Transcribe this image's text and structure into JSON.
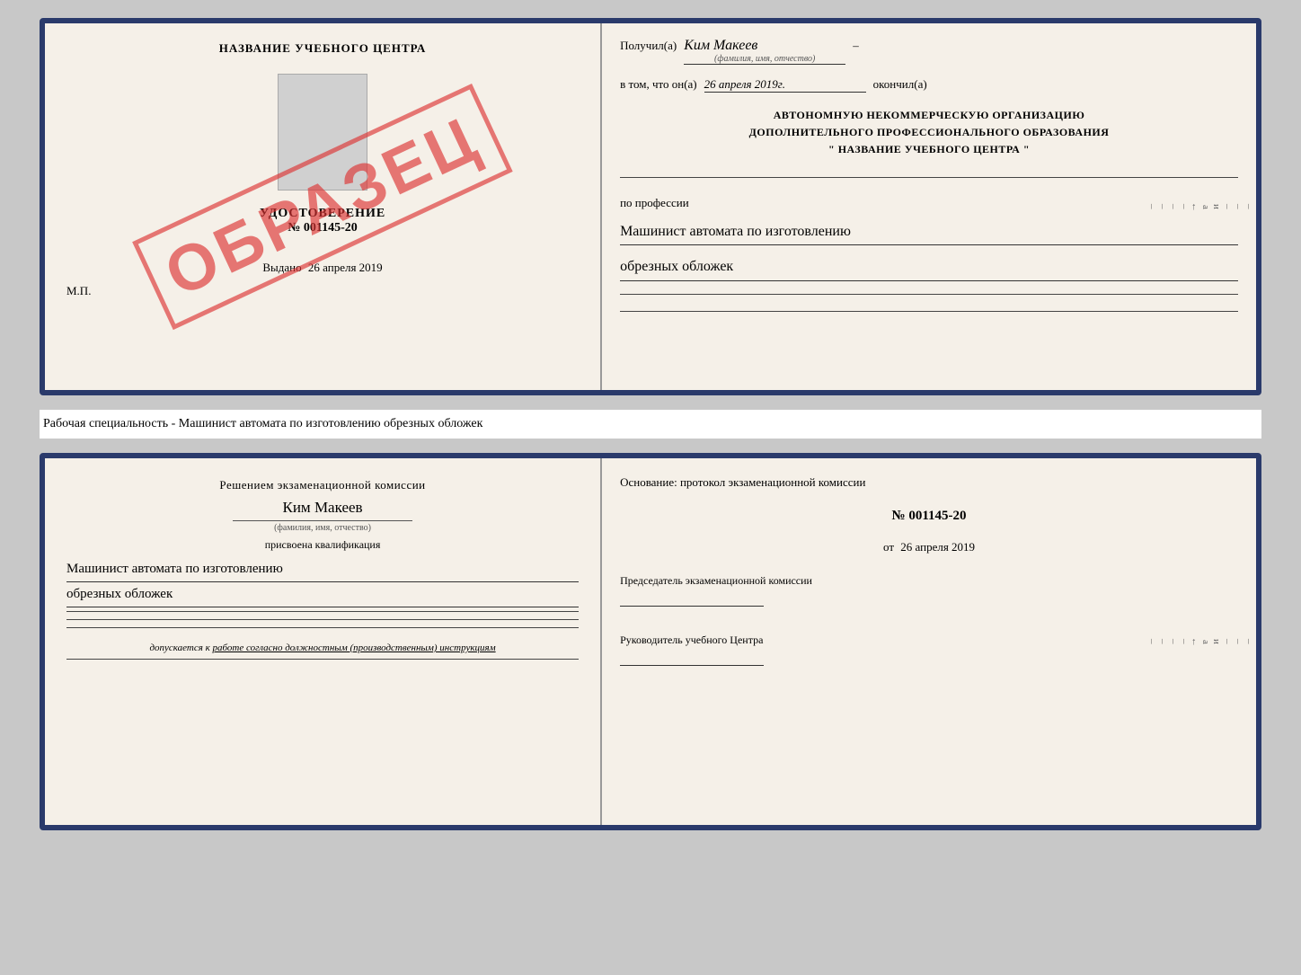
{
  "top_document": {
    "left": {
      "title": "НАЗВАНИЕ УЧЕБНОГО ЦЕНТРА",
      "stamp_text": "ОБРАЗЕЦ",
      "udostoverenie_label": "УДОСТОВЕРЕНИЕ",
      "number": "№ 001145-20",
      "vydano_label": "Выдано",
      "vydano_date": "26 апреля 2019",
      "mp": "М.П."
    },
    "right": {
      "poluchil_label": "Получил(а)",
      "recipient_name": "Ким Макеев",
      "fio_label": "(фамилия, имя, отчество)",
      "vtom_label": "в том, что он(а)",
      "date_value": "26 апреля 2019г.",
      "okonchil_label": "окончил(а)",
      "org_line1": "АВТОНОМНУЮ НЕКОММЕРЧЕСКУЮ ОРГАНИЗАЦИЮ",
      "org_line2": "ДОПОЛНИТЕЛЬНОГО ПРОФЕССИОНАЛЬНОГО ОБРАЗОВАНИЯ",
      "org_line3": "\"  НАЗВАНИЕ УЧЕБНОГО ЦЕНТРА  \"",
      "po_professii_label": "по профессии",
      "profession_line1": "Машинист автомата по изготовлению",
      "profession_line2": "обрезных обложек"
    }
  },
  "separator": {
    "text": "Рабочая специальность - Машинист автомата по изготовлению обрезных обложек"
  },
  "bottom_document": {
    "left": {
      "resheniem_label": "Решением экзаменационной комиссии",
      "name": "Ким Макеев",
      "fio_label": "(фамилия, имя, отчество)",
      "prisvoena_label": "присвоена квалификация",
      "profession_line1": "Машинист автомата по изготовлению",
      "profession_line2": "обрезных обложек",
      "dopuskaetsya_label": "допускается к",
      "dopuskaetsya_text": "работе согласно должностным (производственным) инструкциям"
    },
    "right": {
      "osnovaniye_label": "Основание: протокол экзаменационной комиссии",
      "protocol_num": "№  001145-20",
      "ot_label": "от",
      "ot_date": "26 апреля 2019",
      "predsedatel_label": "Председатель экзаменационной комиссии",
      "rukovoditel_label": "Руководитель учебного Центра"
    }
  },
  "edge_marks": [
    "–",
    "–",
    "–",
    "и",
    "а̓",
    "←",
    "–",
    "–",
    "–",
    "–"
  ]
}
